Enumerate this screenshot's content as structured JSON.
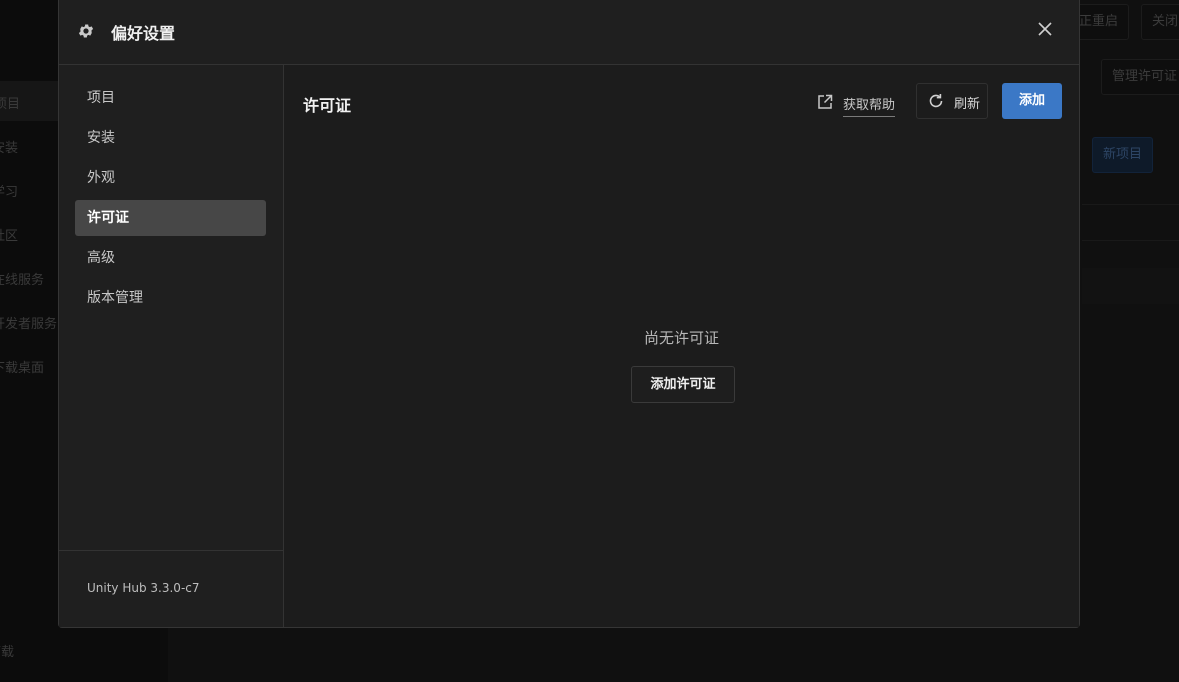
{
  "background_app": {
    "sidebar": [
      "项目",
      "安装",
      "学习",
      "社区",
      "在线服务",
      "开发者服务",
      "下载桌面",
      "下载"
    ],
    "top_buttons": [
      "正重启",
      "关闭"
    ],
    "manage_license_label": "管理许可证",
    "new_project_label": "新项目"
  },
  "modal": {
    "title": "偏好设置",
    "icons": {
      "settings": "gear-icon",
      "close": "close-icon"
    },
    "nav": [
      {
        "label": "项目"
      },
      {
        "label": "安装"
      },
      {
        "label": "外观"
      },
      {
        "label": "许可证",
        "active": true
      },
      {
        "label": "高级"
      },
      {
        "label": "版本管理"
      }
    ],
    "version": "Unity Hub 3.3.0-c7",
    "content": {
      "title": "许可证",
      "help_label": "获取帮助",
      "refresh_label": "刷新",
      "add_label": "添加",
      "empty_text": "尚无许可证",
      "empty_button": "添加许可证"
    }
  },
  "colors": {
    "accent": "#3b78c6",
    "active_nav": "#474747",
    "modal_bg": "#1f1f1f"
  }
}
